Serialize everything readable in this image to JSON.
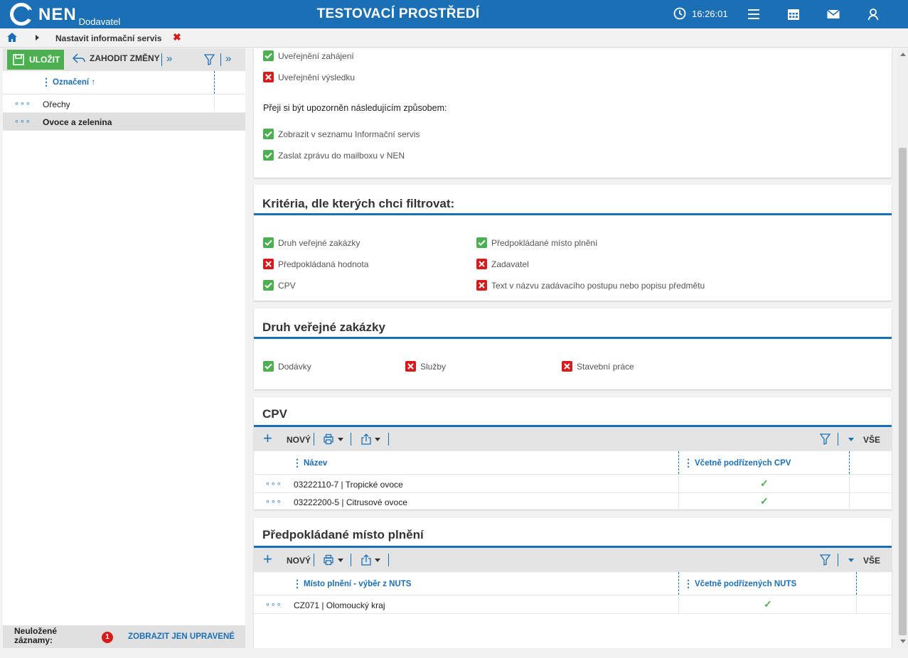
{
  "header": {
    "logo_text": "NEN",
    "logo_sub": "Dodavatel",
    "env_title": "TESTOVACÍ PROSTŘEDÍ",
    "clock": "16:26:01"
  },
  "breadcrumb": {
    "title": "Nastavit informační servis",
    "close": "✖"
  },
  "left_panel": {
    "save_label": "ULOŽIT",
    "discard_label": "ZAHODIT ZMĚNY",
    "more_glyph": "»",
    "column_header": "Označení ↑",
    "rows": [
      {
        "label": "Ořechy",
        "selected": false
      },
      {
        "label": "Ovoce a zelenina",
        "selected": true
      }
    ],
    "footer_label": "Neuložené záznamy:",
    "footer_count": "1",
    "footer_link": "ZOBRAZIT JEN UPRAVENÉ"
  },
  "notification": {
    "items": [
      {
        "label": "Uveřejnění zahájení",
        "checked": true
      },
      {
        "label": "Uveřejnění výsledku",
        "checked": false
      }
    ],
    "method_label": "Přeji si být upozorněn následujícím způsobem:",
    "methods": [
      {
        "label": "Zobrazit v seznamu Informační servis",
        "checked": true
      },
      {
        "label": "Zaslat zprávu do mailboxu v NEN",
        "checked": true
      }
    ]
  },
  "criteria": {
    "title": "Kritéria, dle kterých chci filtrovat:",
    "items": [
      {
        "label": "Druh veřejné zakázky",
        "checked": true
      },
      {
        "label": "Předpokládaná hodnota",
        "checked": false
      },
      {
        "label": "CPV",
        "checked": true
      },
      {
        "label": "Předpokládané místo plnění",
        "checked": true
      },
      {
        "label": "Zadavatel",
        "checked": false
      },
      {
        "label": "Text v názvu zadávacího postupu nebo popisu předmětu",
        "checked": false
      }
    ]
  },
  "contract_type": {
    "title": "Druh veřejné zakázky",
    "items": [
      {
        "label": "Dodávky",
        "checked": true
      },
      {
        "label": "Služby",
        "checked": false
      },
      {
        "label": "Stavební práce",
        "checked": false
      }
    ]
  },
  "cpv": {
    "title": "CPV",
    "new_label": "NOVÝ",
    "all_label": "VŠE",
    "col_name": "Název",
    "col_sub": "Včetně podřízených CPV",
    "rows": [
      {
        "name": "03222110-7 | Tropické ovoce",
        "included": true
      },
      {
        "name": "03222200-5 | Citrusové ovoce",
        "included": true
      }
    ]
  },
  "place": {
    "title": "Předpokládané místo plnění",
    "new_label": "NOVÝ",
    "all_label": "VŠE",
    "col_name": "Místo plnění - výběr z NUTS",
    "col_sub": "Včetně podřízených NUTS",
    "rows": [
      {
        "name": "CZ071 | Olomoucký kraj",
        "included": true
      }
    ]
  },
  "colors": {
    "brand": "#1b6fb5",
    "yes": "#4caf50",
    "no": "#d71a1a"
  },
  "icons": {
    "check": "✓"
  }
}
